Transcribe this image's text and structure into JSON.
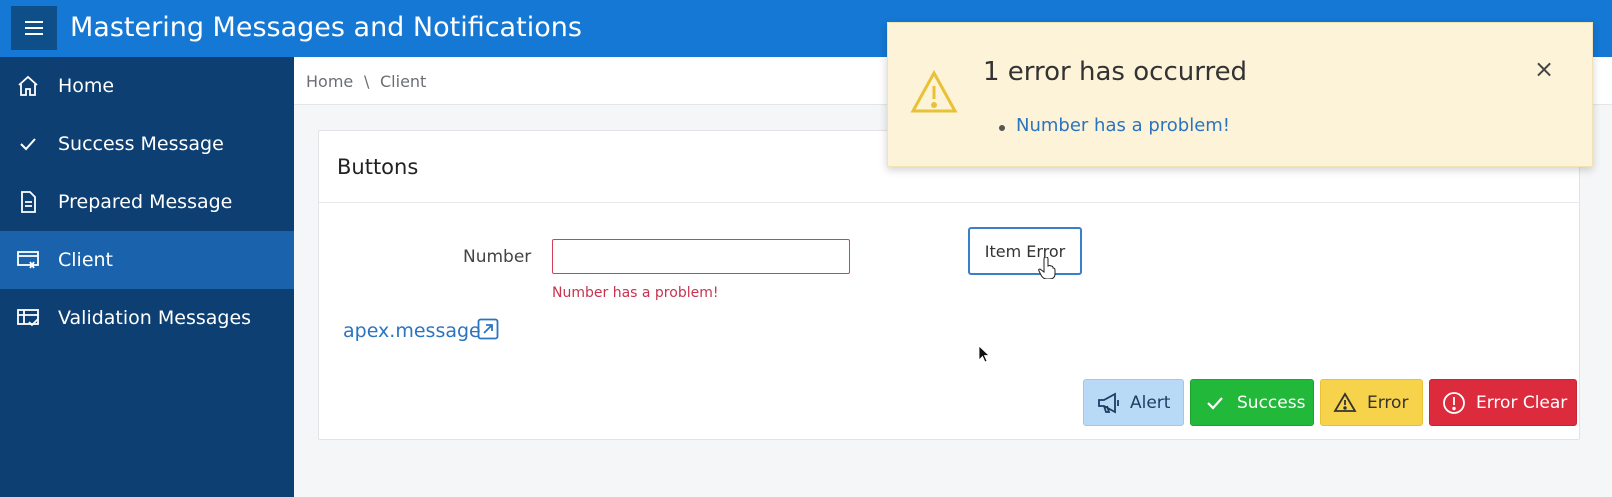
{
  "header": {
    "title": "Mastering Messages and Notifications",
    "menu_icon": "hamburger-icon"
  },
  "sidebar": {
    "items": [
      {
        "label": "Home",
        "icon": "home-icon",
        "active": false
      },
      {
        "label": "Success Message",
        "icon": "check-icon",
        "active": false
      },
      {
        "label": "Prepared Message",
        "icon": "document-icon",
        "active": false
      },
      {
        "label": "Client",
        "icon": "client-icon",
        "active": true
      },
      {
        "label": "Validation Messages",
        "icon": "table-check-icon",
        "active": false
      }
    ]
  },
  "breadcrumb": {
    "items": [
      "Home",
      "Client"
    ],
    "separator": "\\"
  },
  "region": {
    "title": "Buttons"
  },
  "form": {
    "number_label": "Number",
    "number_value": "",
    "number_error": "Number has a problem!"
  },
  "item_error_button": "Item Error",
  "link": {
    "label": "apex.message"
  },
  "actions": {
    "alert": "Alert",
    "success": "Success",
    "error": "Error",
    "error_clear": "Error Clear"
  },
  "notification": {
    "title": "1 error has occurred",
    "messages": [
      "Number has a problem!"
    ],
    "close": "×"
  },
  "colors": {
    "header": "#1478d4",
    "sidebar": "#0d3f72",
    "sidebar_active": "#1a63ac",
    "alert": "#b9daf7",
    "success": "#22b83a",
    "error": "#f7d24b",
    "error_clear": "#dd2b3e",
    "notification_bg": "#fdf3d8"
  }
}
